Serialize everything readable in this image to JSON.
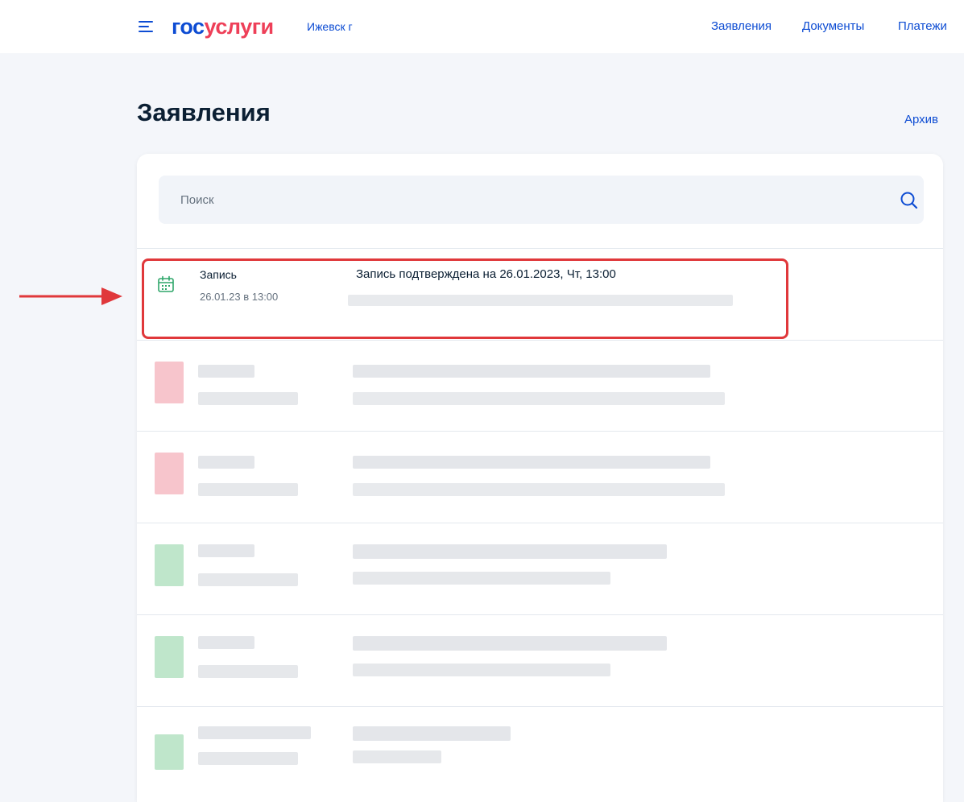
{
  "header": {
    "logo_part1": "гос",
    "logo_part2": "услуги",
    "city": "Ижевск г",
    "nav": [
      "Заявления",
      "Документы",
      "Платежи"
    ]
  },
  "page": {
    "title": "Заявления",
    "archive_link": "Архив"
  },
  "search": {
    "placeholder": "Поиск"
  },
  "applications": [
    {
      "title": "Запись",
      "date": "26.01.23 в 13:00",
      "status": "Запись подтверждена на 26.01.2023, Чт, 13:00",
      "icon": "calendar-icon",
      "highlighted": true
    }
  ],
  "blurred_rows": [
    {
      "icon_color": "#f7c5cc"
    },
    {
      "icon_color": "#f7c5cc"
    },
    {
      "icon_color": "#bfe6cb"
    },
    {
      "icon_color": "#bfe6cb"
    },
    {
      "icon_color": "#bfe6cb"
    }
  ],
  "colors": {
    "brand_blue": "#0d4cd3",
    "brand_red": "#ee3f58",
    "highlight_red": "#e0383b",
    "success_green": "#2fa66a"
  }
}
